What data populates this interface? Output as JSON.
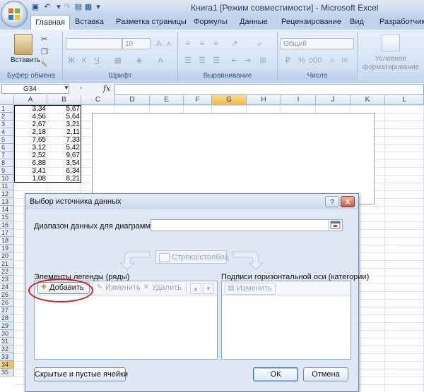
{
  "window": {
    "title": "Книга1  [Режим совместимости] - Microsoft Excel"
  },
  "ribbon": {
    "tabs": [
      "Главная",
      "Вставка",
      "Разметка страницы",
      "Формулы",
      "Данные",
      "Рецензирование",
      "Вид",
      "Разработчик"
    ],
    "paste_label": "Вставить",
    "groups": {
      "clipboard": "Буфер обмена",
      "font": "Шрифт",
      "alignment": "Выравнивание",
      "number": "Число",
      "styles_line1": "Условное",
      "styles_line2": "форматирование"
    },
    "font_size": "10",
    "number_format": "Общий"
  },
  "formula_bar": {
    "cell_ref": "G34",
    "fx": "fx",
    "formula": ""
  },
  "sheet": {
    "columns": [
      "A",
      "B",
      "C",
      "D",
      "E",
      "F",
      "G",
      "H",
      "I",
      "J",
      "K",
      "L"
    ],
    "selected_column": "G",
    "selected_row": "34",
    "rows": [
      "1",
      "2",
      "3",
      "4",
      "5",
      "6",
      "7",
      "8",
      "9",
      "10",
      "11",
      "12",
      "13",
      "14",
      "15",
      "16",
      "17",
      "18",
      "19",
      "20",
      "21",
      "22",
      "23",
      "24",
      "25",
      "26",
      "27",
      "28",
      "29",
      "30",
      "31",
      "32",
      "33",
      "34",
      "35"
    ],
    "data": [
      [
        "3,34",
        "5,67"
      ],
      [
        "4,56",
        "5,64"
      ],
      [
        "2,67",
        "3,21"
      ],
      [
        "2,18",
        "2,11"
      ],
      [
        "7,65",
        "7,33"
      ],
      [
        "3,12",
        "5,42"
      ],
      [
        "2,52",
        "9,67"
      ],
      [
        "6,88",
        "3,54"
      ],
      [
        "3,41",
        "6,34"
      ],
      [
        "1,08",
        "8,21"
      ]
    ]
  },
  "dialog": {
    "title": "Выбор источника данных",
    "help": "?",
    "close": "X",
    "range_label": "Диапазон данных для диаграммы:",
    "range_value": "",
    "swap_button": "Строка/столбец",
    "legend_label": "Элементы легенды (ряды)",
    "axis_label": "Подписи горизонтальной оси (категории)",
    "add_button": "Добавить",
    "edit_button": "Изменить",
    "delete_button": "Удалить",
    "axis_edit_button": "Изменить",
    "hidden_cells_button": "Скрытые и пустые ячейки",
    "ok_button": "ОК",
    "cancel_button": "Отмена"
  },
  "colors": {
    "annotation_ring": "#d21f1f",
    "selected_header": "#f6b94e"
  }
}
